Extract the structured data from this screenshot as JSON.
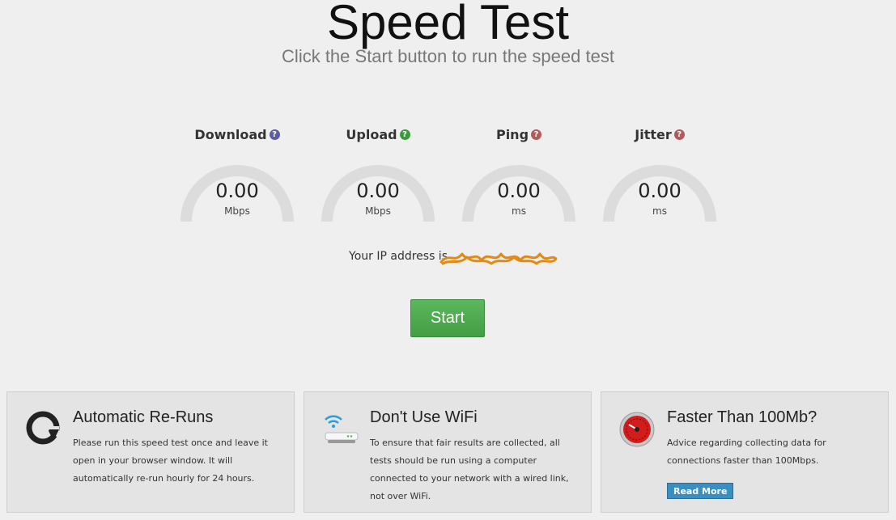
{
  "header": {
    "title": "Speed Test",
    "subtitle": "Click the Start button to run the speed test"
  },
  "gauges": [
    {
      "label": "Download",
      "value": "0.00",
      "unit": "Mbps",
      "help_color": "#5b5ba8"
    },
    {
      "label": "Upload",
      "value": "0.00",
      "unit": "Mbps",
      "help_color": "#3c9a3c"
    },
    {
      "label": "Ping",
      "value": "0.00",
      "unit": "ms",
      "help_color": "#b35a5a"
    },
    {
      "label": "Jitter",
      "value": "0.00",
      "unit": "ms",
      "help_color": "#b35a5a"
    }
  ],
  "ip": {
    "label": "Your IP address is"
  },
  "start": {
    "label": "Start"
  },
  "cards": [
    {
      "title": "Automatic Re-Runs",
      "text": "Please run this speed test once and leave it open in your browser window. It will automatically re-run hourly for 24 hours.",
      "icon": "rerun-icon"
    },
    {
      "title": "Don't Use WiFi",
      "text": "To ensure that fair results are collected, all tests should be run using a computer connected to your network with a wired link, not over WiFi.",
      "icon": "wifi-router-icon"
    },
    {
      "title": "Faster Than 100Mb?",
      "text": "Advice regarding collecting data for connections faster than 100Mbps.",
      "icon": "speedometer-icon",
      "button": "Read More"
    }
  ],
  "help_glyph": "?"
}
